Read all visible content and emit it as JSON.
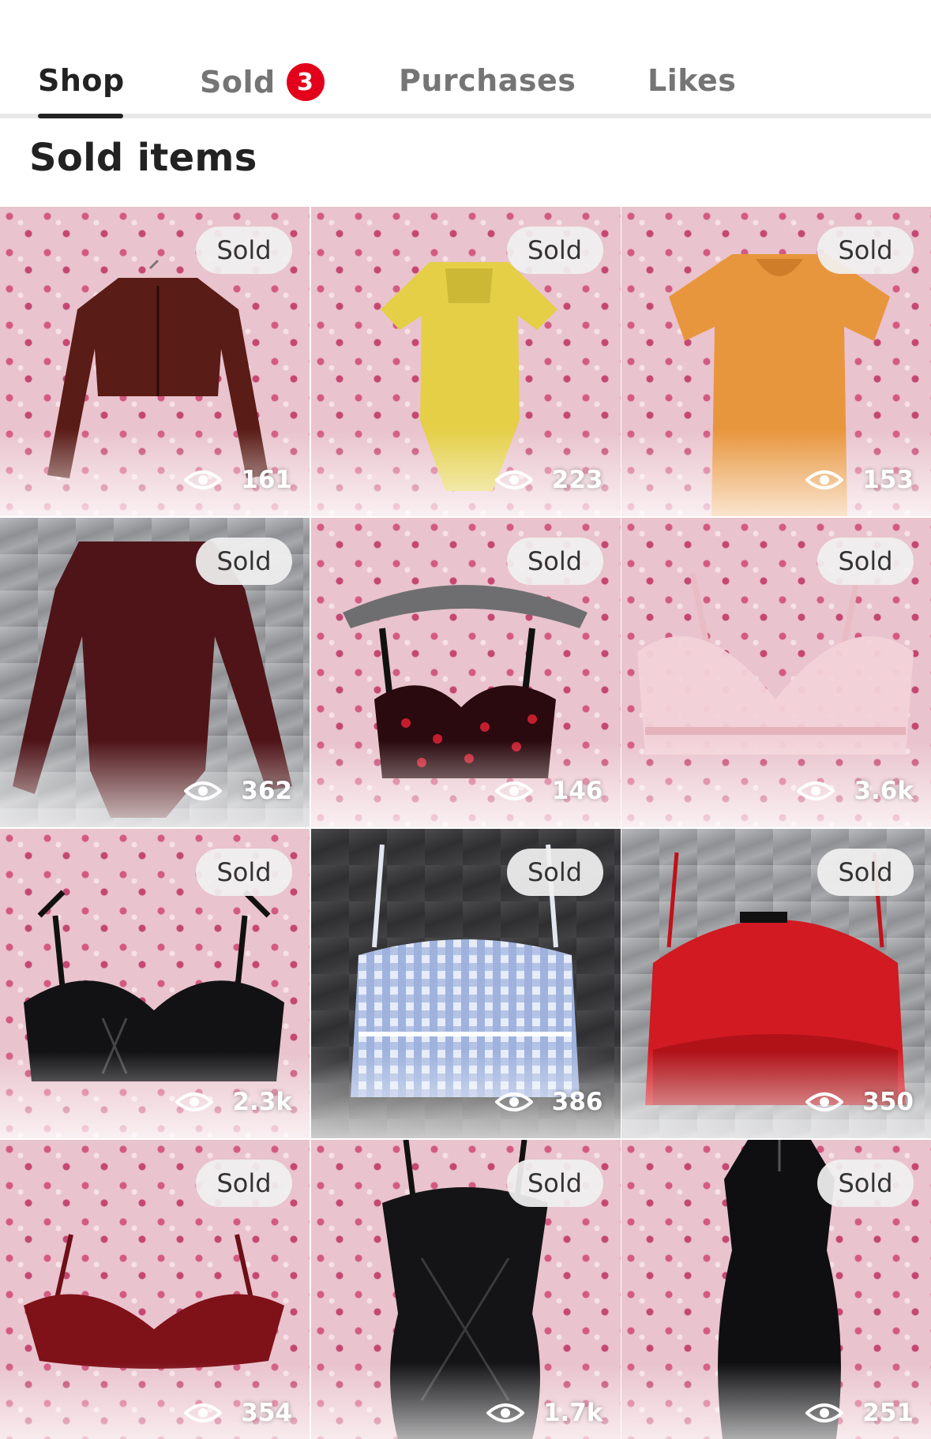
{
  "tabs": [
    {
      "label": "Shop",
      "active": true
    },
    {
      "label": "Sold",
      "badge": "3"
    },
    {
      "label": "Purchases"
    },
    {
      "label": "Likes"
    }
  ],
  "page_title": "Sold items",
  "items": [
    {
      "status": "Sold",
      "views": "161"
    },
    {
      "status": "Sold",
      "views": "223"
    },
    {
      "status": "Sold",
      "views": "153"
    },
    {
      "status": "Sold",
      "views": "362"
    },
    {
      "status": "Sold",
      "views": "146"
    },
    {
      "status": "Sold",
      "views": "3.6k"
    },
    {
      "status": "Sold",
      "views": "2.3k"
    },
    {
      "status": "Sold",
      "views": "386"
    },
    {
      "status": "Sold",
      "views": "350"
    },
    {
      "status": "Sold",
      "views": "354"
    },
    {
      "status": "Sold",
      "views": "1.7k"
    },
    {
      "status": "Sold",
      "views": "251"
    }
  ],
  "icons": {
    "views": "eye-icon"
  },
  "colors": {
    "accent_badge": "#e3001b",
    "text_primary": "#222222",
    "text_muted": "#757575"
  }
}
